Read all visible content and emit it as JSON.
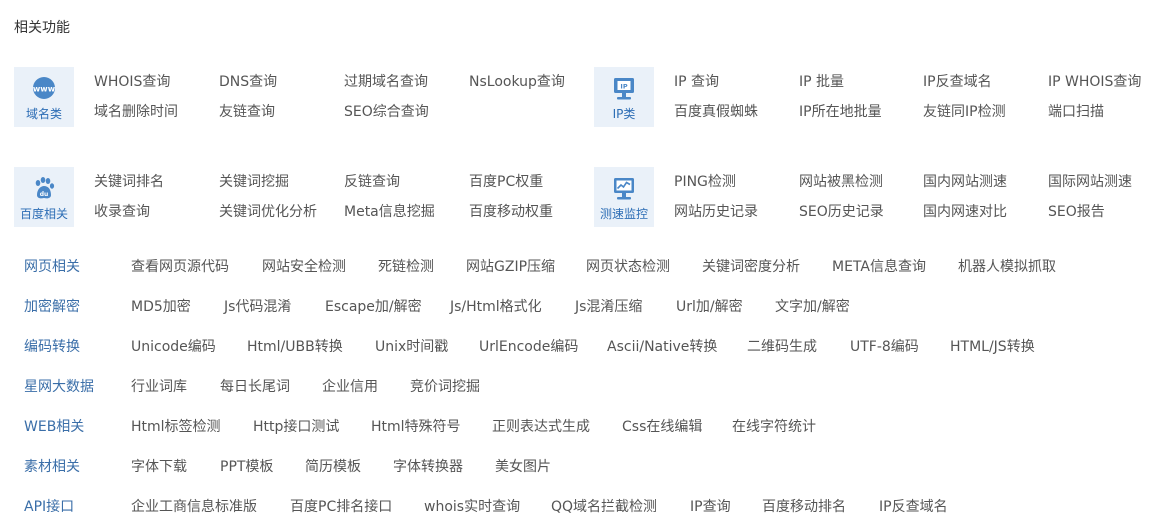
{
  "title": "相关功能",
  "colors": {
    "accent": "#2c6db5",
    "row_label": "#3a6ea8",
    "icon_bg": "#eaf1f9",
    "icon": "#4a87c7",
    "text": "#555555"
  },
  "groups": [
    {
      "label": "域名类",
      "icon": "www-globe-icon",
      "links": [
        "WHOIS查询",
        "DNS查询",
        "过期域名查询",
        "NsLookup查询",
        "域名删除时间",
        "友链查询",
        "SEO综合查询"
      ]
    },
    {
      "label": "IP类",
      "icon": "ip-monitor-icon",
      "links": [
        "IP 查询",
        "IP 批量",
        "IP反查域名",
        "IP WHOIS查询",
        "百度真假蜘蛛",
        "IP所在地批量",
        "友链同IP检测",
        "端口扫描"
      ]
    },
    {
      "label": "百度相关",
      "icon": "baidu-paw-icon",
      "links": [
        "关键词排名",
        "关键词挖掘",
        "反链查询",
        "百度PC权重",
        "收录查询",
        "关键词优化分析",
        "Meta信息挖掘",
        "百度移动权重"
      ]
    },
    {
      "label": "测速监控",
      "icon": "speed-chart-icon",
      "links": [
        "PING检测",
        "网站被黑检测",
        "国内网站测速",
        "国际网站测速",
        "网站历史记录",
        "SEO历史记录",
        "国内网速对比",
        "SEO报告"
      ]
    }
  ],
  "rows": [
    {
      "label": "网页相关",
      "links": [
        "查看网页源代码",
        "网站安全检测",
        "死链检测",
        "网站GZIP压缩",
        "网页状态检测",
        "关键词密度分析",
        "META信息查询",
        "机器人模拟抓取"
      ]
    },
    {
      "label": "加密解密",
      "links": [
        "MD5加密",
        "Js代码混淆",
        "Escape加/解密",
        "Js/Html格式化",
        "Js混淆压缩",
        "Url加/解密",
        "文字加/解密"
      ]
    },
    {
      "label": "编码转换",
      "links": [
        "Unicode编码",
        "Html/UBB转换",
        "Unix时间戳",
        "UrlEncode编码",
        "Ascii/Native转换",
        "二维码生成",
        "UTF-8编码",
        "HTML/JS转换"
      ]
    },
    {
      "label": "星网大数据",
      "links": [
        "行业词库",
        "每日长尾词",
        "企业信用",
        "竞价词挖掘"
      ]
    },
    {
      "label": "WEB相关",
      "links": [
        "Html标签检测",
        "Http接口测试",
        "Html特殊符号",
        "正则表达式生成",
        "Css在线编辑",
        "在线字符统计"
      ]
    },
    {
      "label": "素材相关",
      "links": [
        "字体下载",
        "PPT模板",
        "简历模板",
        "字体转换器",
        "美女图片"
      ]
    },
    {
      "label": "API接口",
      "links": [
        "企业工商信息标准版",
        "百度PC排名接口",
        "whois实时查询",
        "QQ域名拦截检测",
        "IP查询",
        "百度移动排名",
        "IP反查域名"
      ]
    }
  ]
}
